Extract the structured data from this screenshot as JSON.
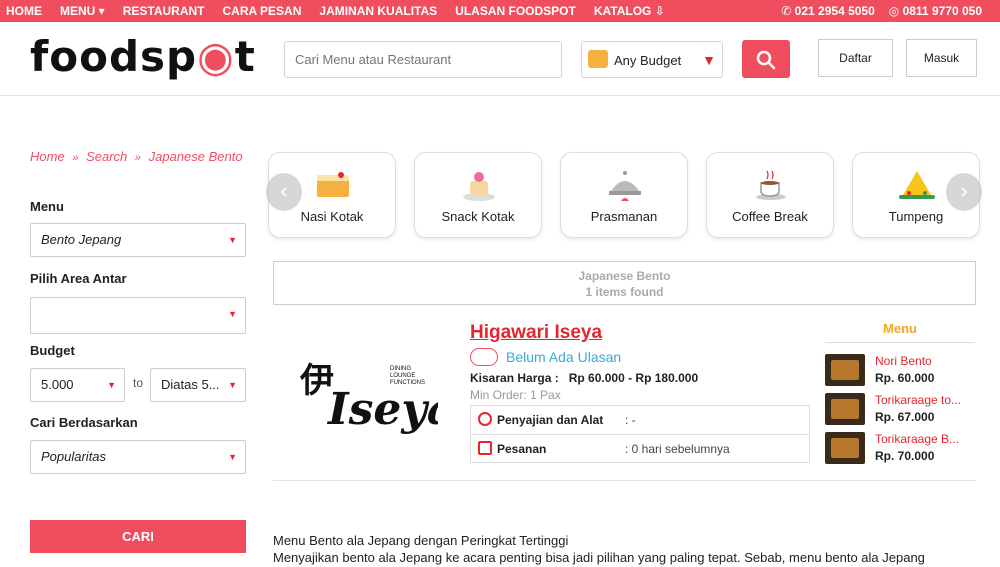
{
  "topbar": {
    "nav": [
      "HOME",
      "MENU ▾",
      "RESTAURANT",
      "CARA PESAN",
      "JAMINAN KUALITAS",
      "ULASAN FOODSPOT",
      "KATALOG ⇩"
    ],
    "phone": "✆  021 2954 5050",
    "whatsapp": "◎  0811 9770 050"
  },
  "header": {
    "logo_text_1": "foodsp",
    "logo_text_2": "t",
    "search_placeholder": "Cari Menu atau Restaurant",
    "budget_label": "Any Budget",
    "daftar_label": "Daftar",
    "masuk_label": "Masuk"
  },
  "breadcrumb": {
    "home": "Home",
    "search": "Search",
    "current": "Japanese Bento",
    "sep": "»"
  },
  "filters": {
    "menu_label": "Menu",
    "menu_value": "Bento Jepang",
    "area_label": "Pilih Area Antar",
    "area_value": "",
    "budget_label": "Budget",
    "budget_from": "5.000",
    "budget_to_text": "to",
    "budget_to": "Diatas 5...",
    "sort_label": "Cari Berdasarkan",
    "sort_value": "Popularitas",
    "cari_label": "CARI"
  },
  "categories": [
    {
      "label": "Nasi Kotak",
      "icon": "nasi-kotak-icon"
    },
    {
      "label": "Snack Kotak",
      "icon": "snack-kotak-icon"
    },
    {
      "label": "Prasmanan",
      "icon": "prasmanan-icon"
    },
    {
      "label": "Coffee Break",
      "icon": "coffee-break-icon"
    },
    {
      "label": "Tumpeng",
      "icon": "tumpeng-icon"
    }
  ],
  "results": {
    "title": "Japanese Bento",
    "count": "1 items found"
  },
  "restaurant": {
    "name": "Higawari Iseya",
    "review": "Belum Ada Ulasan",
    "price_label": "Kisaran Harga :",
    "price_value": "Rp 60.000 - Rp 180.000",
    "min_order": "Min Order: 1 Pax",
    "logo_sub": [
      "DINING",
      "LOUNGE",
      "FUNCTIONS"
    ],
    "rows": [
      {
        "key": "Penyajian dan Alat",
        "value": ": -"
      },
      {
        "key": "Pesanan",
        "value": ": 0 hari sebelumnya"
      }
    ],
    "menu_header": "Menu",
    "menu_items": [
      {
        "name": "Nori Bento",
        "price": "Rp. 60.000"
      },
      {
        "name": "Torikaraage to...",
        "price": "Rp. 67.000"
      },
      {
        "name": "Torikaraage B...",
        "price": "Rp. 70.000"
      }
    ]
  },
  "description": {
    "title": "Menu Bento ala Jepang dengan Peringkat Tertinggi",
    "body": "Menyajikan bento ala Jepang ke acara penting bisa jadi pilihan yang paling tepat. Sebab, menu bento ala Jepang"
  },
  "colors": {
    "brand": "#f04e5f",
    "accent_red": "#e8242f",
    "menu_header": "#f5a623",
    "review": "#3aa9d9"
  }
}
